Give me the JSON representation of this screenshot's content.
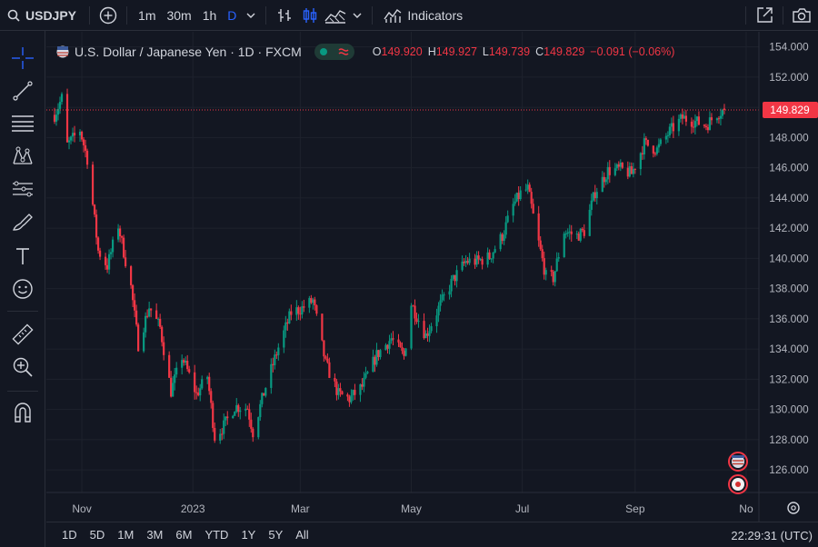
{
  "header": {
    "symbol": "USDJPY",
    "timeframes": [
      "1m",
      "30m",
      "1h",
      "D"
    ],
    "active_timeframe": "D",
    "indicators_label": "Indicators",
    "accent_color": "#2962ff"
  },
  "legend": {
    "title": "U.S. Dollar / Japanese Yen · 1D · FXCM",
    "open_label": "O",
    "open": "149.920",
    "high_label": "H",
    "high": "149.927",
    "low_label": "L",
    "low": "149.739",
    "close_label": "C",
    "close": "149.829",
    "change": "−0.091 (−0.06%)"
  },
  "left_tools": [
    "crosshair-icon",
    "trend-line-icon",
    "fib-retracement-icon",
    "pattern-icon",
    "forecast-icon",
    "brush-icon",
    "text-icon",
    "emoji-icon",
    "ruler-icon",
    "zoom-icon",
    "magnet-icon"
  ],
  "bottom": {
    "ranges": [
      "1D",
      "5D",
      "1M",
      "3M",
      "6M",
      "YTD",
      "1Y",
      "5Y",
      "All"
    ],
    "clock": "22:29:31 (UTC)"
  },
  "chart_data": {
    "type": "candlestick",
    "up_color": "#089981",
    "down_color": "#f23645",
    "ylim": [
      124.5,
      155
    ],
    "y_ticks": [
      126,
      128,
      130,
      132,
      134,
      136,
      138,
      140,
      142,
      144,
      146,
      148,
      150,
      152,
      154
    ],
    "y_tick_labels": [
      "126.000",
      "128.000",
      "130.000",
      "132.000",
      "134.000",
      "136.000",
      "138.000",
      "140.000",
      "142.000",
      "144.000",
      "146.000",
      "148.000",
      "150.000",
      "152.000",
      "154.000"
    ],
    "x_tick_labels": [
      "Nov",
      "2023",
      "Mar",
      "May",
      "Jul",
      "Sep",
      "No"
    ],
    "x_tick_dates": [
      "2022-11-01",
      "2023-01-01",
      "2023-03-01",
      "2023-05-01",
      "2023-07-01",
      "2023-09-01",
      "2023-11-01"
    ],
    "x_range": [
      "2022-10-15",
      "2023-11-08"
    ],
    "last_price": 149.829,
    "last_price_label": "149.829",
    "anchors": [
      [
        "2022-10-17",
        149.5
      ],
      [
        "2022-10-21",
        150.6
      ],
      [
        "2022-10-24",
        147.5
      ],
      [
        "2022-10-31",
        148.5
      ],
      [
        "2022-11-04",
        146.6
      ],
      [
        "2022-11-10",
        140.5
      ],
      [
        "2022-11-15",
        139.5
      ],
      [
        "2022-11-21",
        142.2
      ],
      [
        "2022-11-28",
        138.1
      ],
      [
        "2022-12-02",
        134.3
      ],
      [
        "2022-12-08",
        136.8
      ],
      [
        "2022-12-14",
        135.4
      ],
      [
        "2022-12-20",
        131.2
      ],
      [
        "2022-12-26",
        133.5
      ],
      [
        "2023-01-03",
        131.0
      ],
      [
        "2023-01-09",
        132.2
      ],
      [
        "2023-01-13",
        128.2
      ],
      [
        "2023-01-18",
        128.9
      ],
      [
        "2023-01-24",
        130.2
      ],
      [
        "2023-01-31",
        130.1
      ],
      [
        "2023-02-03",
        128.5
      ],
      [
        "2023-02-10",
        131.5
      ],
      [
        "2023-02-17",
        134.1
      ],
      [
        "2023-02-24",
        136.4
      ],
      [
        "2023-03-02",
        136.7
      ],
      [
        "2023-03-08",
        137.2
      ],
      [
        "2023-03-15",
        133.0
      ],
      [
        "2023-03-22",
        131.0
      ],
      [
        "2023-03-28",
        130.7
      ],
      [
        "2023-04-04",
        131.5
      ],
      [
        "2023-04-12",
        133.6
      ],
      [
        "2023-04-20",
        134.7
      ],
      [
        "2023-04-27",
        133.5
      ],
      [
        "2023-05-01",
        137.0
      ],
      [
        "2023-05-09",
        134.9
      ],
      [
        "2023-05-16",
        136.7
      ],
      [
        "2023-05-24",
        138.6
      ],
      [
        "2023-05-31",
        139.8
      ],
      [
        "2023-06-06",
        139.8
      ],
      [
        "2023-06-13",
        140.1
      ],
      [
        "2023-06-20",
        141.5
      ],
      [
        "2023-06-26",
        143.5
      ],
      [
        "2023-06-30",
        144.3
      ],
      [
        "2023-07-04",
        144.6
      ],
      [
        "2023-07-10",
        141.0
      ],
      [
        "2023-07-14",
        138.8
      ],
      [
        "2023-07-18",
        138.7
      ],
      [
        "2023-07-24",
        141.8
      ],
      [
        "2023-07-31",
        141.5
      ],
      [
        "2023-08-04",
        141.8
      ],
      [
        "2023-08-10",
        144.4
      ],
      [
        "2023-08-17",
        145.8
      ],
      [
        "2023-08-24",
        145.9
      ],
      [
        "2023-08-30",
        145.6
      ],
      [
        "2023-09-06",
        147.6
      ],
      [
        "2023-09-13",
        147.2
      ],
      [
        "2023-09-20",
        148.4
      ],
      [
        "2023-09-27",
        149.3
      ],
      [
        "2023-10-03",
        149.1
      ],
      [
        "2023-10-10",
        148.8
      ],
      [
        "2023-10-16",
        149.6
      ],
      [
        "2023-10-20",
        149.829
      ]
    ]
  }
}
